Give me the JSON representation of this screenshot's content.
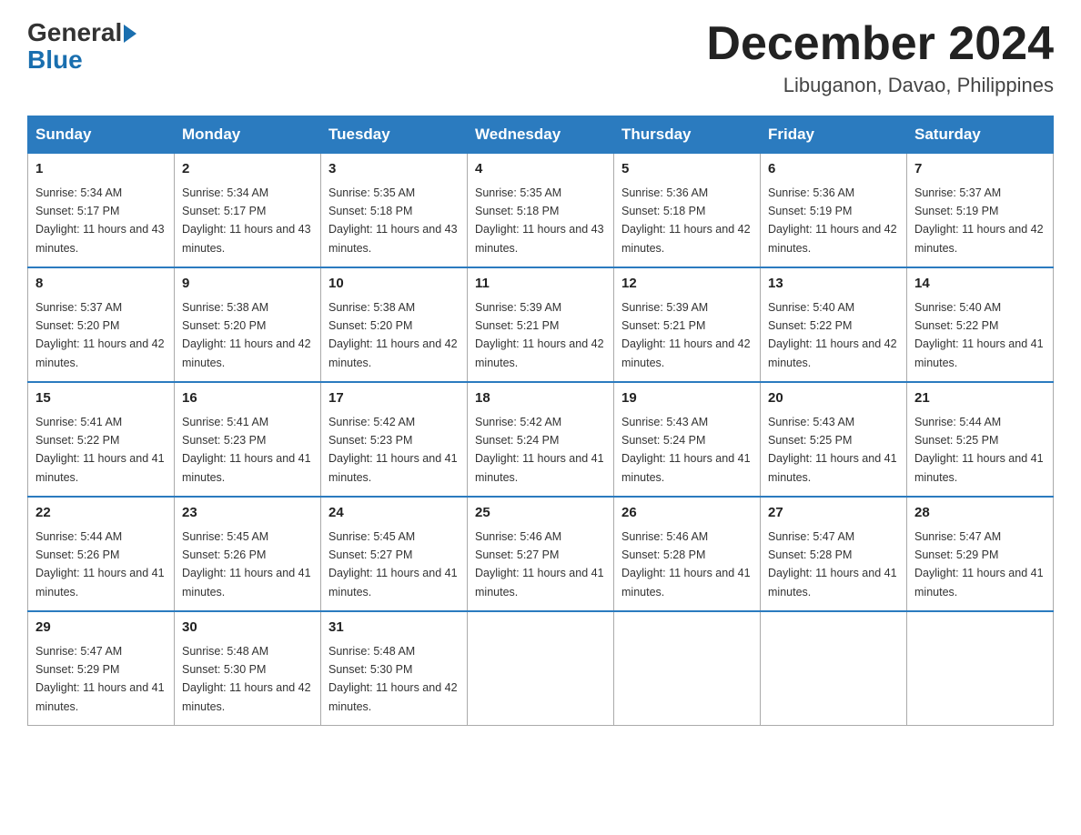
{
  "logo": {
    "general": "General",
    "arrow": "",
    "blue": "Blue"
  },
  "header": {
    "month_title": "December 2024",
    "location": "Libuganon, Davao, Philippines"
  },
  "days_of_week": [
    "Sunday",
    "Monday",
    "Tuesday",
    "Wednesday",
    "Thursday",
    "Friday",
    "Saturday"
  ],
  "weeks": [
    [
      {
        "day": "1",
        "sunrise": "5:34 AM",
        "sunset": "5:17 PM",
        "daylight": "11 hours and 43 minutes."
      },
      {
        "day": "2",
        "sunrise": "5:34 AM",
        "sunset": "5:17 PM",
        "daylight": "11 hours and 43 minutes."
      },
      {
        "day": "3",
        "sunrise": "5:35 AM",
        "sunset": "5:18 PM",
        "daylight": "11 hours and 43 minutes."
      },
      {
        "day": "4",
        "sunrise": "5:35 AM",
        "sunset": "5:18 PM",
        "daylight": "11 hours and 43 minutes."
      },
      {
        "day": "5",
        "sunrise": "5:36 AM",
        "sunset": "5:18 PM",
        "daylight": "11 hours and 42 minutes."
      },
      {
        "day": "6",
        "sunrise": "5:36 AM",
        "sunset": "5:19 PM",
        "daylight": "11 hours and 42 minutes."
      },
      {
        "day": "7",
        "sunrise": "5:37 AM",
        "sunset": "5:19 PM",
        "daylight": "11 hours and 42 minutes."
      }
    ],
    [
      {
        "day": "8",
        "sunrise": "5:37 AM",
        "sunset": "5:20 PM",
        "daylight": "11 hours and 42 minutes."
      },
      {
        "day": "9",
        "sunrise": "5:38 AM",
        "sunset": "5:20 PM",
        "daylight": "11 hours and 42 minutes."
      },
      {
        "day": "10",
        "sunrise": "5:38 AM",
        "sunset": "5:20 PM",
        "daylight": "11 hours and 42 minutes."
      },
      {
        "day": "11",
        "sunrise": "5:39 AM",
        "sunset": "5:21 PM",
        "daylight": "11 hours and 42 minutes."
      },
      {
        "day": "12",
        "sunrise": "5:39 AM",
        "sunset": "5:21 PM",
        "daylight": "11 hours and 42 minutes."
      },
      {
        "day": "13",
        "sunrise": "5:40 AM",
        "sunset": "5:22 PM",
        "daylight": "11 hours and 42 minutes."
      },
      {
        "day": "14",
        "sunrise": "5:40 AM",
        "sunset": "5:22 PM",
        "daylight": "11 hours and 41 minutes."
      }
    ],
    [
      {
        "day": "15",
        "sunrise": "5:41 AM",
        "sunset": "5:22 PM",
        "daylight": "11 hours and 41 minutes."
      },
      {
        "day": "16",
        "sunrise": "5:41 AM",
        "sunset": "5:23 PM",
        "daylight": "11 hours and 41 minutes."
      },
      {
        "day": "17",
        "sunrise": "5:42 AM",
        "sunset": "5:23 PM",
        "daylight": "11 hours and 41 minutes."
      },
      {
        "day": "18",
        "sunrise": "5:42 AM",
        "sunset": "5:24 PM",
        "daylight": "11 hours and 41 minutes."
      },
      {
        "day": "19",
        "sunrise": "5:43 AM",
        "sunset": "5:24 PM",
        "daylight": "11 hours and 41 minutes."
      },
      {
        "day": "20",
        "sunrise": "5:43 AM",
        "sunset": "5:25 PM",
        "daylight": "11 hours and 41 minutes."
      },
      {
        "day": "21",
        "sunrise": "5:44 AM",
        "sunset": "5:25 PM",
        "daylight": "11 hours and 41 minutes."
      }
    ],
    [
      {
        "day": "22",
        "sunrise": "5:44 AM",
        "sunset": "5:26 PM",
        "daylight": "11 hours and 41 minutes."
      },
      {
        "day": "23",
        "sunrise": "5:45 AM",
        "sunset": "5:26 PM",
        "daylight": "11 hours and 41 minutes."
      },
      {
        "day": "24",
        "sunrise": "5:45 AM",
        "sunset": "5:27 PM",
        "daylight": "11 hours and 41 minutes."
      },
      {
        "day": "25",
        "sunrise": "5:46 AM",
        "sunset": "5:27 PM",
        "daylight": "11 hours and 41 minutes."
      },
      {
        "day": "26",
        "sunrise": "5:46 AM",
        "sunset": "5:28 PM",
        "daylight": "11 hours and 41 minutes."
      },
      {
        "day": "27",
        "sunrise": "5:47 AM",
        "sunset": "5:28 PM",
        "daylight": "11 hours and 41 minutes."
      },
      {
        "day": "28",
        "sunrise": "5:47 AM",
        "sunset": "5:29 PM",
        "daylight": "11 hours and 41 minutes."
      }
    ],
    [
      {
        "day": "29",
        "sunrise": "5:47 AM",
        "sunset": "5:29 PM",
        "daylight": "11 hours and 41 minutes."
      },
      {
        "day": "30",
        "sunrise": "5:48 AM",
        "sunset": "5:30 PM",
        "daylight": "11 hours and 42 minutes."
      },
      {
        "day": "31",
        "sunrise": "5:48 AM",
        "sunset": "5:30 PM",
        "daylight": "11 hours and 42 minutes."
      },
      null,
      null,
      null,
      null
    ]
  ]
}
